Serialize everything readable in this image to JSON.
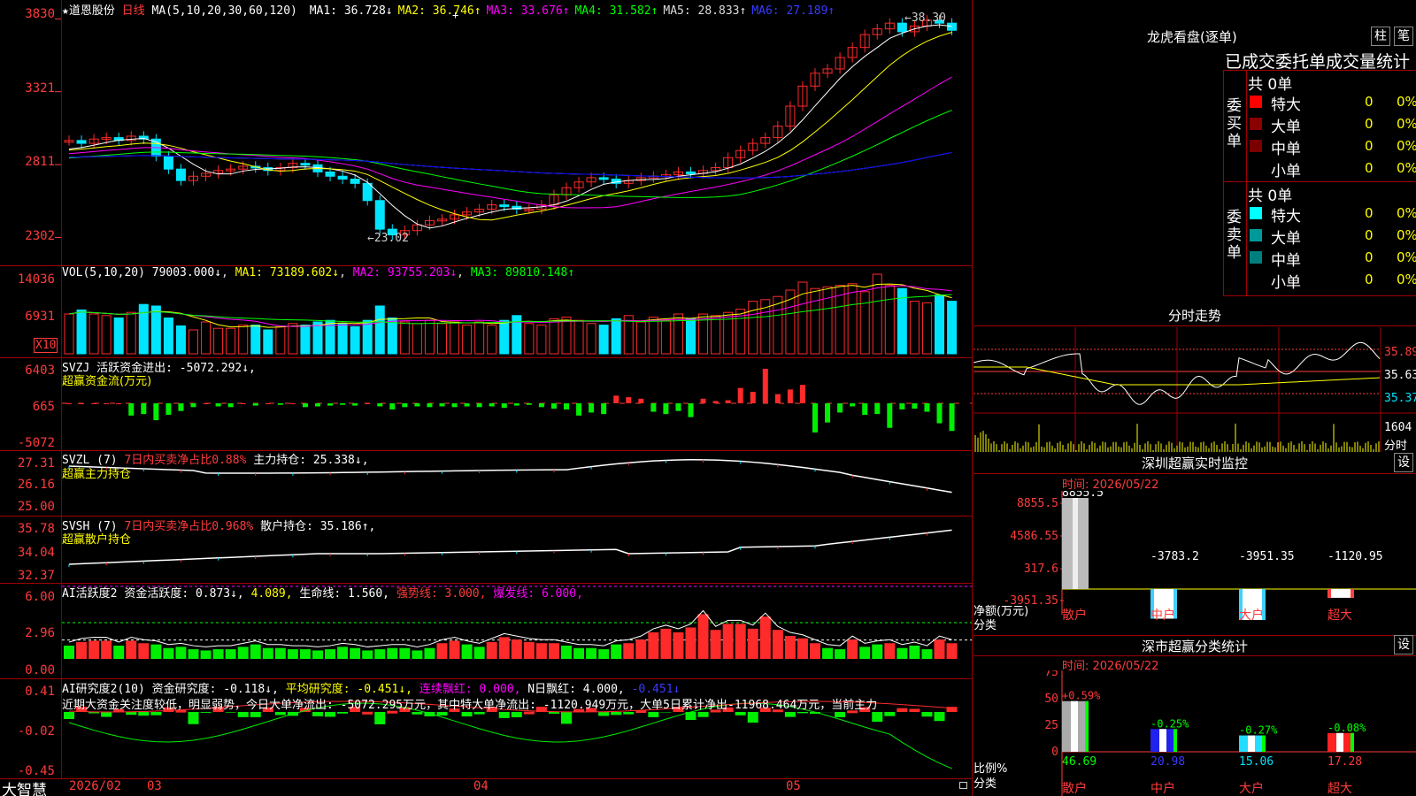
{
  "colors": {
    "up": "#ff2a2a",
    "down": "#00e5ff",
    "ma1": "#ffffff",
    "ma2": "#ffff00",
    "ma3": "#ff00ff",
    "ma4": "#00ff00",
    "ma5": "#bbbbbb",
    "ma6": "#0000ff",
    "bg": "#000000",
    "grid": "#a00000"
  },
  "main": {
    "title": "★道恩股份",
    "period": "日线",
    "ma_set": "MA(5,10,20,30,60,120)",
    "ma": [
      {
        "label": "MA1:",
        "value": "36.728",
        "arrow": "↓",
        "color": "#ffffff"
      },
      {
        "label": "MA2:",
        "value": "36.746",
        "arrow": "↑",
        "color": "#ffff00"
      },
      {
        "label": "MA3:",
        "value": "33.676",
        "arrow": "↑",
        "color": "#ff00ff"
      },
      {
        "label": "MA4:",
        "value": "31.582",
        "arrow": "↑",
        "color": "#00ff00"
      },
      {
        "label": "MA5:",
        "value": "28.833",
        "arrow": "↑",
        "color": "#dddddd"
      },
      {
        "label": "MA6:",
        "value": "27.189",
        "arrow": "↑",
        "color": "#3a3aff"
      }
    ],
    "yticks": [
      "3830",
      "3321",
      "2811",
      "2302"
    ],
    "high_note": "←38.30",
    "low_note": "←23.02",
    "price_range": [
      22.0,
      39.0
    ]
  },
  "vol": {
    "label": "VOL(5,10,20)",
    "value": "79003.000↓",
    "ma1": "MA1: 73189.602↓",
    "ma2": "MA2: 93755.203↓",
    "ma3": "MA3: 89810.148↑",
    "yticks": [
      "14036",
      "6931"
    ],
    "unit": "X10"
  },
  "svzj": {
    "label": "SVZJ",
    "desc": "活跃资金进出: -5072.292↓,",
    "title": "超赢资金流(万元)",
    "yticks": [
      "6403",
      "665",
      "-5072"
    ],
    "values": [
      0,
      0,
      0,
      0,
      0,
      -1600,
      -1400,
      -2200,
      -1500,
      -1000,
      -500,
      0,
      -400,
      -500,
      0,
      -300,
      0,
      -200,
      0,
      -500,
      -400,
      -300,
      -200,
      -300,
      0,
      -400,
      -800,
      -500,
      -400,
      -500,
      -400,
      -500,
      -400,
      -500,
      -400,
      -600,
      -300,
      -200,
      -500,
      -700,
      -800,
      -1600,
      -1200,
      -1400,
      1000,
      800,
      600,
      -1100,
      -1400,
      -1000,
      -1800,
      600,
      300,
      400,
      2000,
      1500,
      4500,
      1200,
      1800,
      2400,
      -3800,
      -2500,
      -1200,
      -400,
      -1500,
      -1400,
      -3200,
      -800,
      -700,
      -1100,
      -2600,
      -3600,
      -5000
    ]
  },
  "svzl": {
    "label": "SVZL (7)",
    "desc": "7日内买卖净占比0.88%",
    "hold": "主力持仓: 25.338↓,",
    "title": "超赢主力持仓",
    "yticks": [
      "27.31",
      "26.16",
      "25.00"
    ]
  },
  "svsh": {
    "label": "SVSH (7)",
    "desc": "7日内买卖净占比0.968%",
    "hold": "散户持仓: 35.186↑,",
    "title": "超赢散户持仓",
    "yticks": [
      "35.78",
      "34.04",
      "32.37"
    ]
  },
  "ai1": {
    "label": "AI活跃度2",
    "a": "资金活跃度: 0.873↓,",
    "b": "4.089,",
    "c": "生命线: 1.560,",
    "d": "强势线: 3.000,",
    "e": "爆发线: 6.000,",
    "yticks": [
      "6.00",
      "2.96",
      "0.00"
    ],
    "values": [
      1.1,
      1.4,
      1.5,
      1.5,
      1.1,
      1.5,
      1.3,
      1.2,
      0.9,
      1.0,
      0.8,
      0.7,
      0.8,
      0.8,
      1.0,
      1.2,
      0.9,
      0.9,
      0.8,
      0.8,
      0.7,
      0.8,
      1.0,
      0.9,
      0.7,
      0.8,
      0.9,
      0.9,
      0.7,
      0.9,
      1.3,
      1.5,
      1.2,
      1.0,
      1.4,
      1.8,
      1.6,
      1.4,
      1.3,
      1.3,
      1.1,
      0.9,
      0.9,
      0.8,
      1.2,
      1.3,
      1.6,
      2.2,
      2.5,
      2.2,
      2.6,
      3.7,
      2.4,
      2.9,
      2.9,
      2.5,
      3.5,
      2.4,
      1.9,
      1.7,
      1.3,
      0.9,
      0.8,
      1.6,
      1.0,
      1.2,
      1.3,
      0.9,
      1.1,
      0.8,
      1.6,
      1.3
    ]
  },
  "ai2": {
    "label": "AI研究度2(10)",
    "a": "资金研究度: -0.118↓,",
    "b": "平均研究度: -0.451↓,",
    "c": "连续飘红: 0.000,",
    "d": "N日飘红: 4.000,",
    "e": "-0.451↓",
    "sentence": "近期大资金关注度较低，明显弱势，今日大单净流出: -5072.295万元，其中特大单净流出: -1120.949万元，大单5日累计净出-11968.464万元，当前主力",
    "yticks": [
      "0.41",
      "-0.02",
      "-0.45"
    ]
  },
  "dates": {
    "start": "2026/02",
    "m3": "03",
    "m4": "04",
    "m5": "05"
  },
  "brand": "大智慧",
  "dragon": {
    "title": "龙虎看盘(逐单)",
    "btn1": "柱",
    "btn2": "笔",
    "tabs": "已成交委托单成交量统计",
    "buy_vert": "委买单",
    "sell_vert": "委卖单",
    "buy_total": "共 0单",
    "sell_total": "共 0单",
    "buy": [
      {
        "name": "特大",
        "val": "0",
        "pct": "0%"
      },
      {
        "name": "大单",
        "val": "0",
        "pct": "0%"
      },
      {
        "name": "中单",
        "val": "0",
        "pct": "0%"
      },
      {
        "name": "小单",
        "val": "0",
        "pct": "0%"
      }
    ],
    "sell": [
      {
        "name": "特大",
        "val": "0",
        "pct": "0%"
      },
      {
        "name": "大单",
        "val": "0",
        "pct": "0%"
      },
      {
        "name": "中单",
        "val": "0",
        "pct": "0%"
      },
      {
        "name": "小单",
        "val": "0",
        "pct": "0%"
      }
    ]
  },
  "intraday": {
    "title": "分时走势",
    "y1": "35.89",
    "y2": "35.63",
    "y3": "35.37",
    "vol": "1604",
    "vol_lbl": "分时"
  },
  "monitor": {
    "title": "深圳超赢实时监控",
    "btn": "设",
    "time": "时间: 2026/05/22",
    "yticks": [
      "8855.5",
      "4586.55",
      "317.6",
      "-3951.35"
    ],
    "ylabel": "净额(万元)",
    "xlabel": "分类",
    "cats": [
      "散户",
      "中户",
      "大户",
      "超大"
    ],
    "values": [
      "8855.5",
      "-3783.2",
      "-3951.35",
      "-1120.95"
    ]
  },
  "classify": {
    "title": "深市超赢分类统计",
    "btn": "设",
    "time": "时间: 2026/05/22",
    "yticks": [
      "75",
      "50",
      "25",
      "0"
    ],
    "ylabel": "比例%",
    "xlabel": "分类",
    "cats": [
      "散户",
      "中户",
      "大户",
      "超大"
    ],
    "changes": [
      "+0.59%",
      "-0.25%",
      "-0.27%",
      "-0.08%"
    ],
    "values": [
      "46.69",
      "20.98",
      "15.06",
      "17.28"
    ]
  }
}
